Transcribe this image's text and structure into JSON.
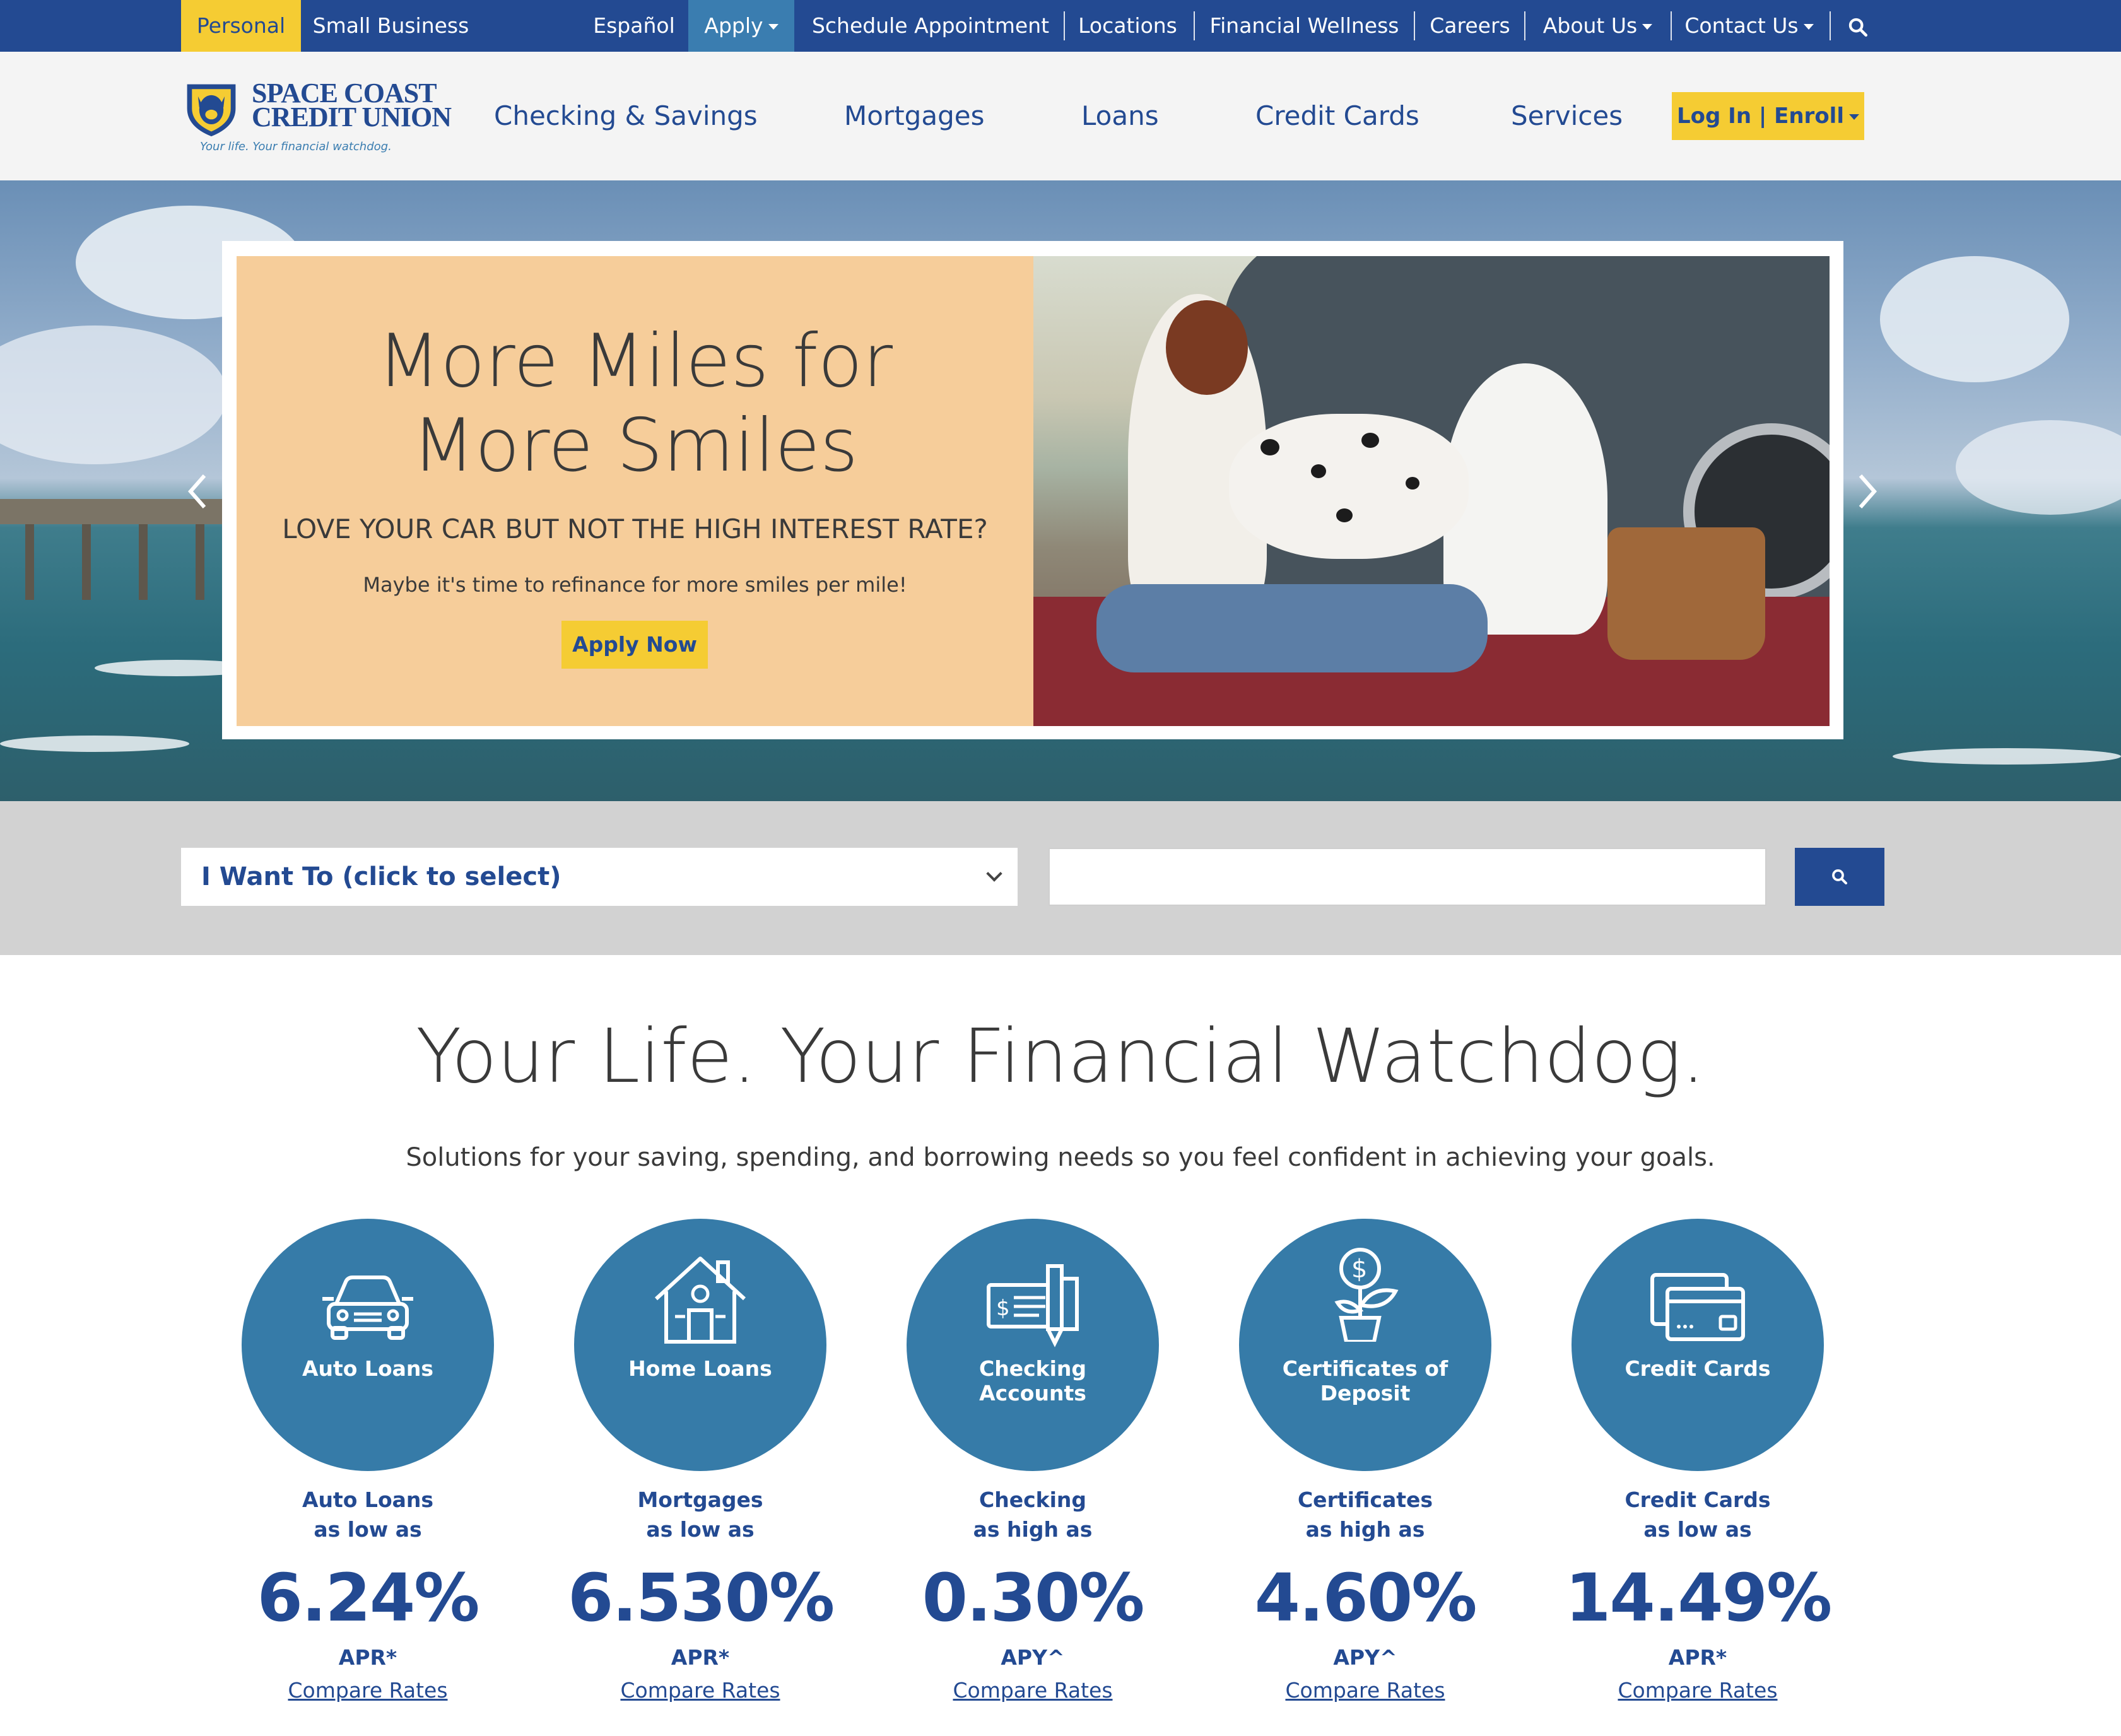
{
  "util_bar": {
    "personal": "Personal",
    "small_business": "Small Business",
    "espanol": "Español",
    "apply": "Apply",
    "schedule": "Schedule Appointment",
    "locations": "Locations",
    "financial_wellness": "Financial Wellness",
    "careers": "Careers",
    "about_us": "About Us",
    "contact_us": "Contact Us",
    "search_icon": "search-icon"
  },
  "brand": {
    "name_line1": "SPACE COAST",
    "name_line2": "CREDIT UNION",
    "tagline": "Your life. Your financial watchdog.",
    "colors": {
      "navy": "#234a92",
      "gold": "#f5cc33",
      "blue": "#367ba8"
    }
  },
  "main_nav": {
    "items": [
      "Checking & Savings",
      "Mortgages",
      "Loans",
      "Credit Cards",
      "Services"
    ],
    "login": "Log In | Enroll"
  },
  "hero": {
    "title_line1": "More Miles for",
    "title_line2": "More Smiles",
    "subtitle": "LOVE YOUR CAR BUT NOT THE HIGH INTEREST RATE?",
    "body": "Maybe it's time to refinance for more smiles per mile!",
    "cta": "Apply Now",
    "prev_icon": "chevron-left-icon",
    "next_icon": "chevron-right-icon"
  },
  "i_want_to": {
    "select_label": "I Want To (click to select)",
    "search_value": "",
    "search_icon": "search-icon"
  },
  "intro": {
    "headline": "Your Life. Your Financial Watchdog.",
    "subhead": "Solutions for your saving, spending, and borrowing needs so you feel confident in achieving your goals."
  },
  "products": [
    {
      "icon": "car-icon",
      "circle_label": "Auto Loans",
      "rate_name": "Auto Loans",
      "qualifier": "as low as",
      "rate": "6.24%",
      "unit": "APR*",
      "link": "Compare Rates"
    },
    {
      "icon": "house-icon",
      "circle_label": "Home Loans",
      "rate_name": "Mortgages",
      "qualifier": "as low as",
      "rate": "6.530%",
      "unit": "APR*",
      "link": "Compare Rates"
    },
    {
      "icon": "check-icon",
      "circle_label": "Checking Accounts",
      "rate_name": "Checking",
      "qualifier": "as high as",
      "rate": "0.30%",
      "unit": "APY^",
      "link": "Compare Rates"
    },
    {
      "icon": "money-plant-icon",
      "circle_label": "Certificates of Deposit",
      "rate_name": "Certificates",
      "qualifier": "as high as",
      "rate": "4.60%",
      "unit": "APY^",
      "link": "Compare Rates"
    },
    {
      "icon": "credit-card-icon",
      "circle_label": "Credit Cards",
      "rate_name": "Credit Cards",
      "qualifier": "as low as",
      "rate": "14.49%",
      "unit": "APR*",
      "link": "Compare Rates"
    }
  ]
}
